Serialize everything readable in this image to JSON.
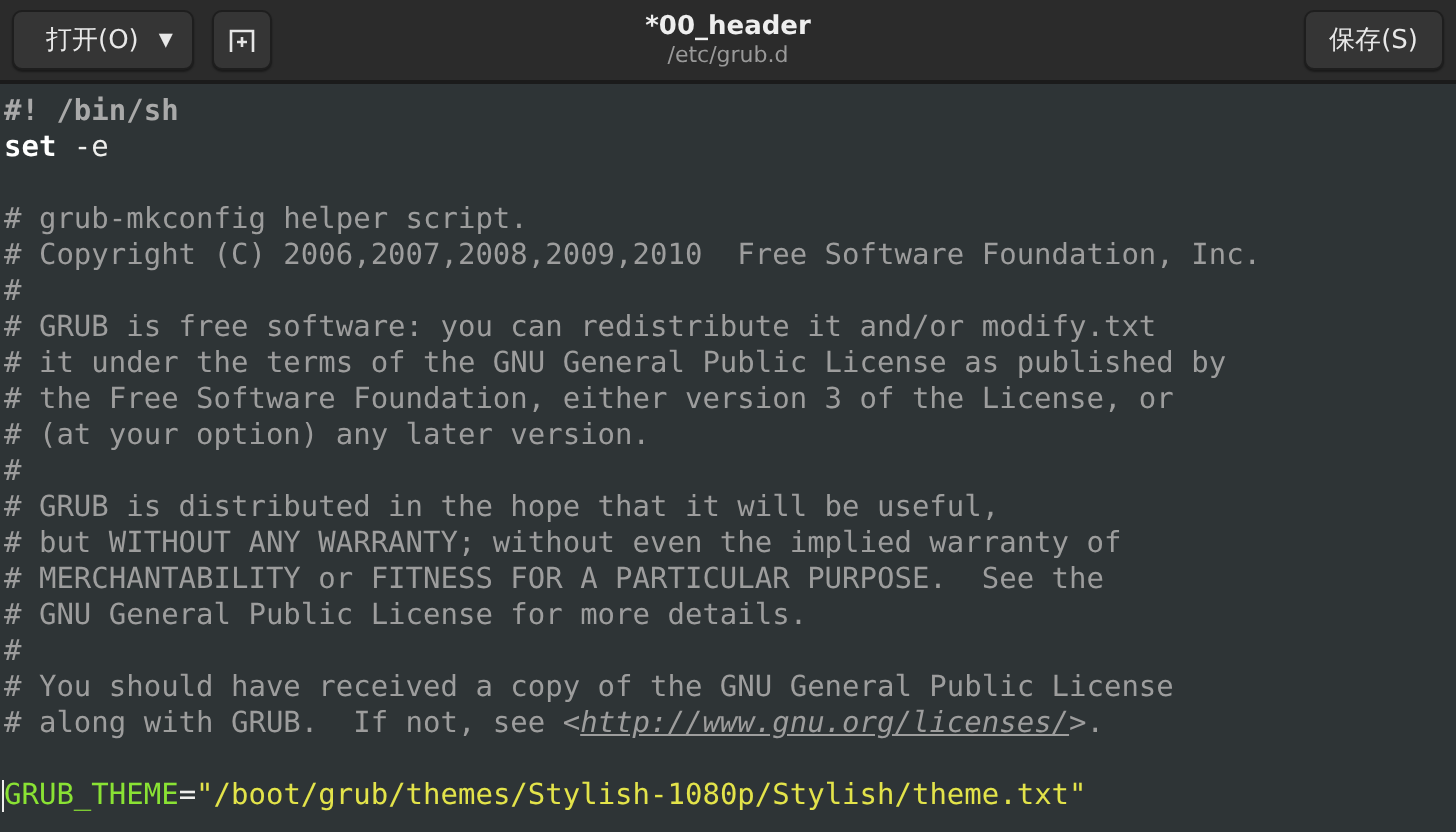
{
  "header": {
    "open_button": {
      "label": "打开(O)",
      "caret": "▾"
    },
    "title": "*00_header",
    "subtitle": "/etc/grub.d",
    "save_button": {
      "label": "保存(S)"
    }
  },
  "editor": {
    "lines": [
      {
        "kind": "code",
        "segments": [
          {
            "kind": "shebang",
            "text": "#! /bin/sh"
          }
        ]
      },
      {
        "kind": "code",
        "segments": [
          {
            "kind": "keyword",
            "text": "set"
          },
          {
            "kind": "plain",
            "text": " -e"
          }
        ]
      },
      {
        "kind": "blank"
      },
      {
        "kind": "code",
        "segments": [
          {
            "kind": "comment",
            "text": "# grub-mkconfig helper script."
          }
        ]
      },
      {
        "kind": "code",
        "segments": [
          {
            "kind": "comment",
            "text": "# Copyright (C) 2006,2007,2008,2009,2010  Free Software Foundation, Inc."
          }
        ]
      },
      {
        "kind": "code",
        "segments": [
          {
            "kind": "comment",
            "text": "#"
          }
        ]
      },
      {
        "kind": "code",
        "segments": [
          {
            "kind": "comment",
            "text": "# GRUB is free software: you can redistribute it and/or modify.txt"
          }
        ]
      },
      {
        "kind": "code",
        "segments": [
          {
            "kind": "comment",
            "text": "# it under the terms of the GNU General Public License as published by"
          }
        ]
      },
      {
        "kind": "code",
        "segments": [
          {
            "kind": "comment",
            "text": "# the Free Software Foundation, either version 3 of the License, or"
          }
        ]
      },
      {
        "kind": "code",
        "segments": [
          {
            "kind": "comment",
            "text": "# (at your option) any later version."
          }
        ]
      },
      {
        "kind": "code",
        "segments": [
          {
            "kind": "comment",
            "text": "#"
          }
        ]
      },
      {
        "kind": "code",
        "segments": [
          {
            "kind": "comment",
            "text": "# GRUB is distributed in the hope that it will be useful,"
          }
        ]
      },
      {
        "kind": "code",
        "segments": [
          {
            "kind": "comment",
            "text": "# but WITHOUT ANY WARRANTY; without even the implied warranty of"
          }
        ]
      },
      {
        "kind": "code",
        "segments": [
          {
            "kind": "comment",
            "text": "# MERCHANTABILITY or FITNESS FOR A PARTICULAR PURPOSE.  See the"
          }
        ]
      },
      {
        "kind": "code",
        "segments": [
          {
            "kind": "comment",
            "text": "# GNU General Public License for more details."
          }
        ]
      },
      {
        "kind": "code",
        "segments": [
          {
            "kind": "comment",
            "text": "#"
          }
        ]
      },
      {
        "kind": "code",
        "segments": [
          {
            "kind": "comment",
            "text": "# You should have received a copy of the GNU General Public License"
          }
        ]
      },
      {
        "kind": "code",
        "segments": [
          {
            "kind": "comment",
            "text": "# along with GRUB.  If not, see <"
          },
          {
            "kind": "link",
            "text": "http://www.gnu.org/licenses/"
          },
          {
            "kind": "comment",
            "text": ">."
          }
        ]
      },
      {
        "kind": "blank"
      },
      {
        "kind": "code",
        "cursor": true,
        "segments": [
          {
            "kind": "variable",
            "text": "GRUB_THEME"
          },
          {
            "kind": "plain",
            "text": "="
          },
          {
            "kind": "string",
            "text": "\"/boot/grub/themes/Stylish-1080p/Stylish/theme.txt\""
          }
        ]
      }
    ]
  }
}
